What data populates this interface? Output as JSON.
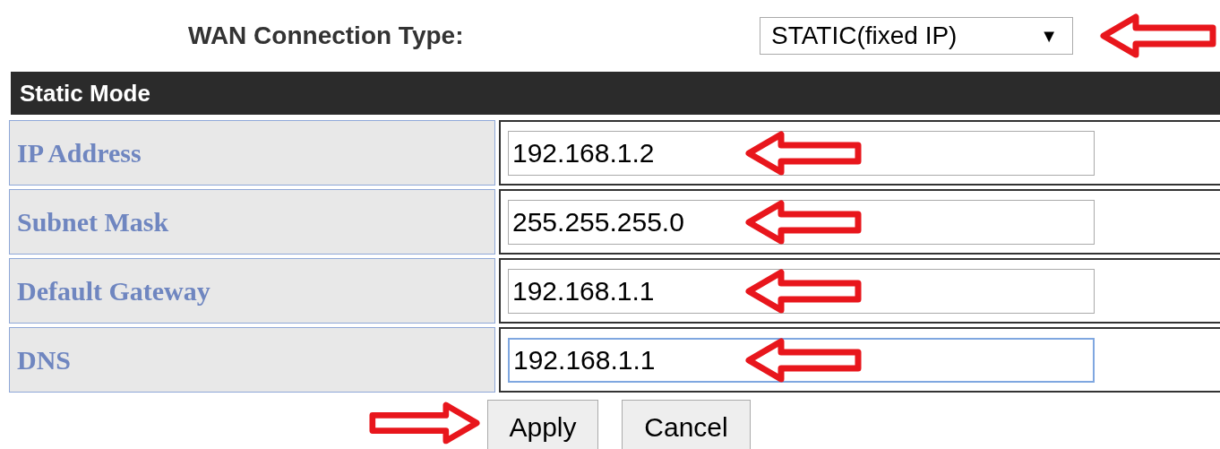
{
  "wan": {
    "label": "WAN Connection Type:",
    "value": "STATIC(fixed IP)",
    "caret": "▼"
  },
  "section": {
    "title": "Static Mode"
  },
  "fields": [
    {
      "label": "IP Address",
      "value": "192.168.1.2",
      "focused": false
    },
    {
      "label": "Subnet Mask",
      "value": "255.255.255.0",
      "focused": false
    },
    {
      "label": "Default Gateway",
      "value": "192.168.1.1",
      "focused": false
    },
    {
      "label": "DNS",
      "value": "192.168.1.1",
      "focused": true
    }
  ],
  "buttons": [
    "Apply",
    "Cancel"
  ]
}
